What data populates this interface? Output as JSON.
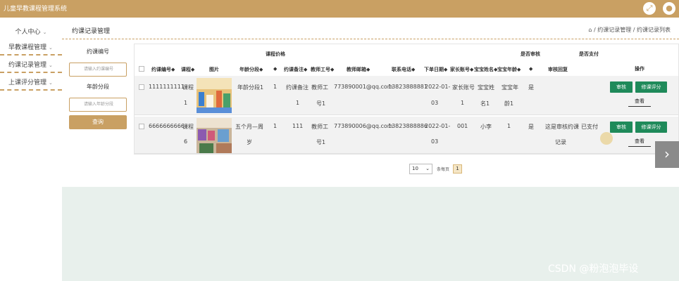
{
  "app": {
    "title": "儿童早教课程管理系统"
  },
  "top_icons": [
    "expand-icon",
    "user-icon"
  ],
  "sidebar": {
    "items": [
      {
        "label": "个人中心"
      },
      {
        "label": "早教课程管理"
      },
      {
        "label": "约课记录管理"
      },
      {
        "label": "上课评分管理"
      }
    ]
  },
  "page": {
    "title": "约课记录管理",
    "breadcrumb": "⌂ / 约课记录管理 / 约课记录列表"
  },
  "search": {
    "field1_label": "约课编号",
    "field1_placeholder": "请输入约课编号",
    "field2_label": "年龄分段",
    "field2_placeholder": "请输入年龄分段",
    "button_label": "查询"
  },
  "table": {
    "group_headers": [
      "课程价格",
      "是否审核",
      "是否支付",
      "操作"
    ],
    "headers": [
      "约课编号◆",
      "课程◆",
      "图片",
      "年龄分段◆",
      "◆",
      "约课备注◆",
      "教师工号◆",
      "教师邮箱◆",
      "联系电话◆",
      "下单日期◆",
      "家长账号◆",
      "宝宝姓名◆",
      "宝宝年龄◆",
      "◆",
      "审核回复"
    ],
    "rows": [
      {
        "id": "1111111111",
        "course_l1": "课程",
        "course_l2": "1",
        "age": "年龄分段1",
        "price": "1",
        "note_l1": "约课备注",
        "note_l2": "1",
        "teacher_l1": "教师工",
        "teacher_l2": "号1",
        "email": "773890001@qq.com",
        "phone": "13823888881",
        "date_l1": "2022-01-",
        "date_l2": "03",
        "parent_l1": "家长账号",
        "parent_l2": "1",
        "baby_l1": "宝宝姓",
        "baby_l2": "名1",
        "babyage_l1": "宝宝年",
        "babyage_l2": "龄1",
        "approved": "是",
        "reply_l1": "",
        "reply_l2": "",
        "paid": "",
        "btn_review": "审核",
        "btn_rate": "修课评分",
        "btn_view": "查看"
      },
      {
        "id": "6666666666",
        "course_l1": "课程",
        "course_l2": "6",
        "age": "五个月—周",
        "age_l2": "岁",
        "price": "1",
        "note_l1": "111",
        "note_l2": "",
        "teacher_l1": "教师工",
        "teacher_l2": "号1",
        "email": "773890006@qq.com",
        "phone": "13823888886",
        "date_l1": "2022-01-",
        "date_l2": "03",
        "parent_l1": "001",
        "parent_l2": "",
        "baby_l1": "小李",
        "baby_l2": "",
        "babyage_l1": "1",
        "babyage_l2": "",
        "approved": "是",
        "reply_l1": "这是审核约课",
        "reply_l2": "记录",
        "paid": "已支付",
        "btn_review": "审核",
        "btn_rate": "修课评分",
        "btn_view": "查看"
      }
    ]
  },
  "pagination": {
    "page_size": "10",
    "page_size_label": "条每页",
    "current_page": "1"
  },
  "next_arrow": "›",
  "watermark": "CSDN @粉泡泡毕设",
  "colors": {
    "brand": "#c9a063",
    "action": "#1f8a5a",
    "band": "#e8f0ec"
  }
}
